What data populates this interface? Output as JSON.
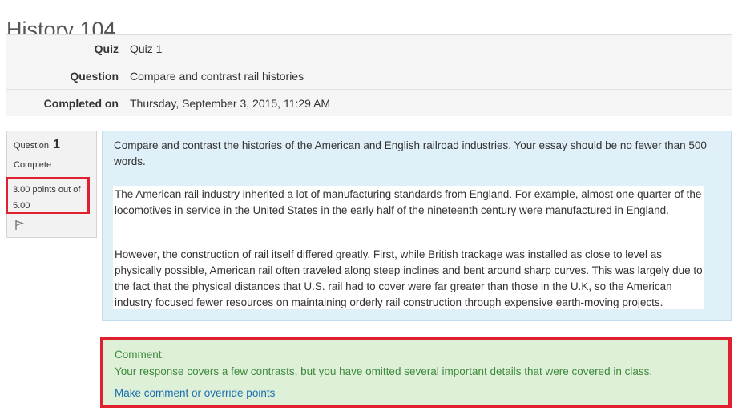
{
  "page": {
    "title": "History 104"
  },
  "summary": {
    "rows": [
      {
        "label": "Quiz",
        "value": "Quiz 1"
      },
      {
        "label": "Question",
        "value": "Compare and contrast rail histories"
      },
      {
        "label": "Completed on",
        "value": "Thursday, September 3, 2015, 11:29 AM"
      }
    ]
  },
  "question_info": {
    "number_label": "Question",
    "number": "1",
    "state": "Complete",
    "grade": "3.00 points out of 5.00",
    "flag_icon": "flag-icon"
  },
  "question": {
    "text": "Compare and contrast the histories of the American and English railroad industries.  Your essay should be no fewer than 500 words.",
    "answer_paragraphs": [
      "The American rail industry inherited a lot of manufacturing standards from England.  For example, almost one quarter of the locomotives in service in the United States in the early half of the nineteenth century were manufactured in England.",
      "However, the construction of rail itself differed greatly.  First, while British trackage was installed as close to level as physically possible, American rail often traveled along steep inclines and bent around sharp curves.  This was largely due to the fact that the physical distances that U.S. rail had to cover were far greater than those in the U.K, so the American industry focused fewer resources on maintaining orderly rail construction through expensive earth-moving projects."
    ]
  },
  "comment": {
    "label": "Comment:",
    "text": "Your response covers a few contrasts, but you have omitted several important details that were covered in class.",
    "link": "Make comment or override points"
  },
  "colors": {
    "highlight_border": "#e0202e",
    "question_bg": "#dff0f8",
    "comment_bg": "#dff0d8",
    "comment_text": "#3c8a3c",
    "link": "#1a6eaf"
  }
}
